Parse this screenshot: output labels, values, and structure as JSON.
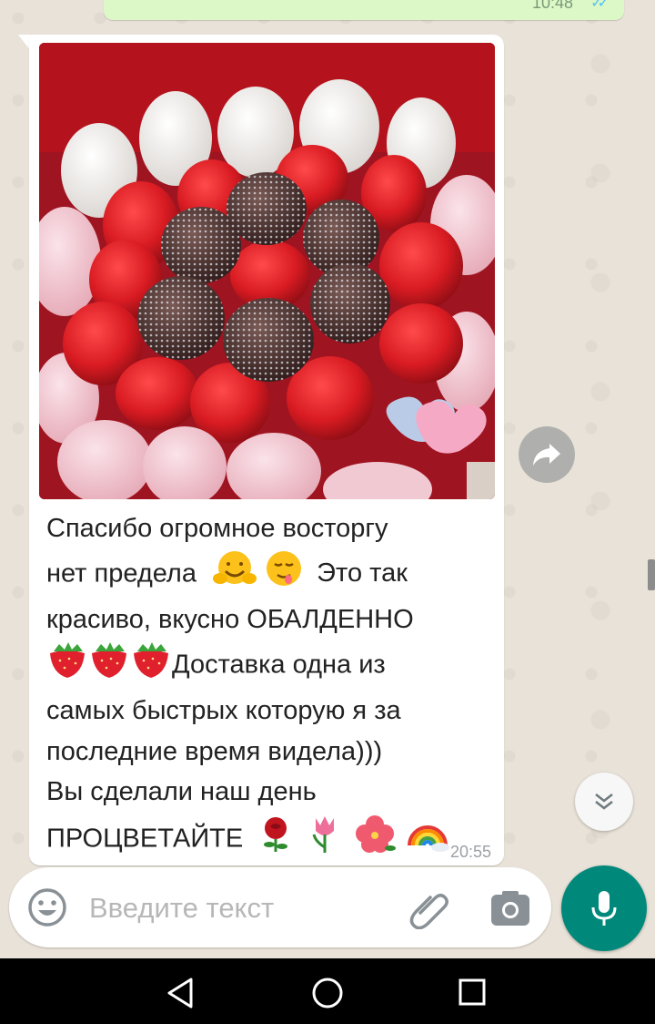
{
  "chat": {
    "previous_message": {
      "time": "10:48"
    },
    "message": {
      "caption_lines": [
        "Спасибо огромное восторгу",
        "нет предела",
        "Это так",
        "красиво, вкусно ОБАЛДЕННО",
        "Доставка одна из",
        "самых быстрых которую я за",
        "последние время видела)))",
        "Вы сделали наш день",
        "ПРОЦВЕТАЙТЕ"
      ],
      "time": "20:55"
    }
  },
  "input": {
    "placeholder": "Введите текст"
  },
  "icons": {
    "forward": "forward-icon",
    "scroll_down": "double-chevron-down-icon",
    "emoji": "smiley-icon",
    "attach": "paperclip-icon",
    "camera": "camera-icon",
    "mic": "microphone-icon",
    "nav_back": "triangle-back-icon",
    "nav_home": "circle-home-icon",
    "nav_recent": "square-recents-icon"
  },
  "colors": {
    "outgoing_bubble": "#dcf8c6",
    "incoming_bubble": "#ffffff",
    "accent": "#00897b",
    "read_ticks": "#4fc3f7"
  }
}
